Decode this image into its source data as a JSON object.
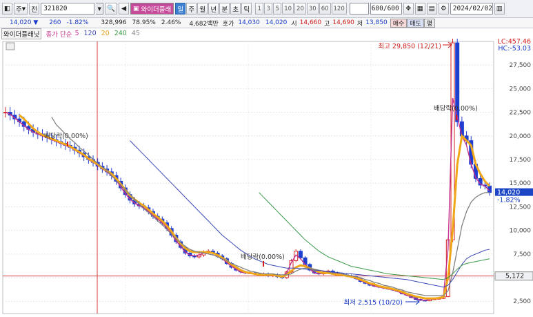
{
  "toolbar": {
    "period_label": "주",
    "search_label": "전",
    "code": "321820",
    "name": "와이더플래",
    "periods": [
      "일",
      "주",
      "월",
      "년",
      "분",
      "초",
      "틱"
    ],
    "period_selected": 0,
    "minutes": [
      "1",
      "3",
      "5",
      "10",
      "20",
      "30",
      "60",
      "120"
    ],
    "count": "600/600",
    "date": "2024/02/02"
  },
  "quote": {
    "price": "14,020",
    "arrow": "▼",
    "change": "260",
    "change_pct": "-1.82%",
    "volume": "328,996",
    "turnover": "78.95%",
    "vol_pct": "2.46%",
    "amount": "4,682백만",
    "hoga_label": "호가",
    "ask": "14,030",
    "bid": "14,020",
    "open_label": "시",
    "open": "14,660",
    "high_label": "고",
    "high": "14,690",
    "low_label": "저",
    "low": "13,850",
    "buy_label": "매수",
    "sell_label": "매도",
    "eval_label": "평"
  },
  "legend": {
    "name": "와이더플래닛",
    "ma_label": "종가 단순",
    "periods": [
      "5",
      "120",
      "20",
      "240",
      "45"
    ],
    "period_colors": [
      "#c62f8c",
      "#3c48b8",
      "#e8a020",
      "#3a9a48",
      "#888888"
    ]
  },
  "annotations": {
    "lc": "LC:457.46",
    "hc": "HC:-53.03",
    "max_label": "최고 29,850 (12/21)",
    "min_label": "최저 2,515 (10/20)",
    "div1": "배당락(0.00%)",
    "div2": "배당락(0.00%)",
    "div3": "배당락(0.00%)",
    "cur_price": "14,020",
    "cur_pct": "-1.82%",
    "level": "5,172"
  },
  "chart_data": {
    "type": "candlestick",
    "y_ticks": [
      2500,
      5000,
      7500,
      10000,
      12500,
      15000,
      17500,
      20000,
      22500,
      25000,
      27500
    ],
    "y_tick_labels": [
      "2,500",
      "5,000",
      "7,500",
      "10,000",
      "12,500",
      "15,000",
      "17,500",
      "20,000",
      "22,500",
      "25,000",
      "27,500"
    ],
    "ylim": [
      1200,
      30000
    ],
    "high": 29850,
    "low": 2515,
    "last": 14020,
    "horizontal_line": 5172,
    "close_series": [
      22500,
      22200,
      21800,
      21500,
      21000,
      20700,
      20400,
      20200,
      20000,
      19800,
      19600,
      19400,
      19200,
      19000,
      18800,
      18500,
      18200,
      17800,
      17500,
      17200,
      16800,
      16500,
      16200,
      15800,
      15200,
      14500,
      13800,
      13200,
      12800,
      12600,
      12400,
      12000,
      11500,
      11200,
      10800,
      10200,
      9500,
      8800,
      8200,
      7600,
      7300,
      7200,
      7400,
      7700,
      7800,
      7600,
      7300,
      7000,
      6500,
      6100,
      5800,
      5600,
      5500,
      5500,
      5400,
      5300,
      5400,
      5200,
      5300,
      5100,
      5000,
      5600,
      6800,
      7800,
      7100,
      6400,
      5800,
      5500,
      5400,
      5600,
      5700,
      5500,
      5400,
      5300,
      5200,
      5100,
      4900,
      4600,
      4400,
      4200,
      4100,
      4000,
      3900,
      3800,
      3700,
      3550,
      3300,
      3150,
      2900,
      2700,
      2600,
      2550,
      2700,
      2750,
      2800,
      3000,
      9000,
      29850,
      21500,
      20000,
      19500,
      17000,
      15500,
      14800,
      14700,
      14020
    ],
    "series": [
      {
        "name": "5",
        "values": [
          22500,
          22300,
          21900,
          21500,
          21100,
          20700,
          20400,
          20200,
          20000,
          19800,
          19600,
          19400,
          19200,
          19000,
          18800,
          18500,
          18200,
          17900,
          17500,
          17200,
          16900,
          16500,
          16200,
          15800,
          15300,
          14600,
          13900,
          13300,
          12900,
          12600,
          12400,
          12000,
          11600,
          11200,
          10800,
          10300,
          9600,
          8900,
          8300,
          7700,
          7400,
          7300,
          7400,
          7600,
          7700,
          7600,
          7300,
          7000,
          6600,
          6200,
          5900,
          5600,
          5500,
          5500,
          5400,
          5300,
          5400,
          5200,
          5300,
          5200,
          5100,
          5500,
          6600,
          7400,
          7000,
          6400,
          5900,
          5500,
          5400,
          5500,
          5600,
          5500,
          5400,
          5300,
          5200,
          5100,
          4900,
          4700,
          4500,
          4300,
          4100,
          4000,
          3900,
          3800,
          3700,
          3550,
          3350,
          3150,
          2950,
          2750,
          2650,
          2600,
          2700,
          2750,
          2800,
          3100,
          8000,
          24000,
          22000,
          20000,
          19000,
          17000,
          15600,
          14900,
          14700,
          14200
        ]
      },
      {
        "name": "20",
        "values": [
          null,
          null,
          null,
          22200,
          21800,
          21300,
          20800,
          20400,
          20100,
          19900,
          19700,
          19500,
          19300,
          19100,
          18900,
          18600,
          18300,
          18000,
          17600,
          17300,
          17000,
          16600,
          16300,
          16000,
          15500,
          14900,
          14300,
          13700,
          13300,
          12900,
          12600,
          12200,
          11800,
          11400,
          11000,
          10500,
          9900,
          9200,
          8600,
          8100,
          7800,
          7700,
          7700,
          7700,
          7700,
          7600,
          7400,
          7100,
          6800,
          6400,
          6100,
          5800,
          5600,
          5500,
          5400,
          5300,
          5300,
          5300,
          5300,
          5200,
          5100,
          5300,
          5700,
          6100,
          6300,
          6200,
          6000,
          5800,
          5600,
          5500,
          5500,
          5400,
          5300,
          5300,
          5200,
          5100,
          5000,
          4800,
          4600,
          4400,
          4300,
          4100,
          4000,
          3900,
          3800,
          3650,
          3500,
          3300,
          3150,
          3000,
          2900,
          2800,
          2800,
          2800,
          2850,
          2950,
          5000,
          10000,
          17000,
          20000,
          19500,
          19000,
          17000,
          16000,
          15200,
          14700
        ]
      },
      {
        "name": "45",
        "values": [
          null,
          null,
          null,
          null,
          null,
          null,
          null,
          null,
          null,
          null,
          22000,
          21200,
          20700,
          20200,
          19700,
          19300,
          18800,
          18400,
          18000,
          17500,
          17100,
          16700,
          16300,
          15800,
          15300,
          14800,
          14300,
          13800,
          13300,
          12800,
          12300,
          11900,
          11500,
          11000,
          10600,
          10100,
          9600,
          9100,
          8700,
          8300,
          8000,
          7800,
          7700,
          7600,
          7500,
          7400,
          7200,
          7000,
          6800,
          6500,
          6300,
          6100,
          5900,
          5700,
          5600,
          5500,
          5400,
          5400,
          5400,
          5300,
          5300,
          5300,
          5400,
          5700,
          5900,
          6000,
          6000,
          5900,
          5800,
          5700,
          5600,
          5500,
          5500,
          5400,
          5300,
          5200,
          5100,
          5000,
          4800,
          4700,
          4500,
          4400,
          4200,
          4100,
          4000,
          3800,
          3700,
          3500,
          3400,
          3300,
          3200,
          3100,
          3100,
          3100,
          3100,
          3100,
          3600,
          5500,
          8000,
          10500,
          12000,
          13000,
          13500,
          13800,
          14000,
          14000
        ]
      },
      {
        "name": "120",
        "values": [
          null,
          null,
          null,
          null,
          null,
          null,
          null,
          null,
          null,
          null,
          null,
          null,
          null,
          null,
          null,
          null,
          null,
          null,
          null,
          null,
          null,
          null,
          null,
          null,
          null,
          null,
          null,
          19500,
          19000,
          18500,
          18000,
          17500,
          17000,
          16500,
          16000,
          15500,
          15000,
          14500,
          14000,
          13500,
          13000,
          12500,
          12000,
          11500,
          11000,
          10500,
          10000,
          9500,
          9100,
          8700,
          8300,
          7900,
          7600,
          7300,
          7000,
          6800,
          6600,
          6400,
          6300,
          6200,
          6100,
          6000,
          6000,
          6000,
          5950,
          5900,
          5850,
          5800,
          5750,
          5700,
          5650,
          5600,
          5550,
          5500,
          5450,
          5400,
          5350,
          5300,
          5250,
          5200,
          5150,
          5100,
          5050,
          5000,
          4950,
          4900,
          4850,
          4800,
          4700,
          4600,
          4500,
          4400,
          4300,
          4200,
          4100,
          4000,
          4200,
          4800,
          5600,
          6400,
          7000,
          7300,
          7500,
          7700,
          7900,
          8000
        ]
      },
      {
        "name": "240",
        "values": [
          null,
          null,
          null,
          null,
          null,
          null,
          null,
          null,
          null,
          null,
          null,
          null,
          null,
          null,
          null,
          null,
          null,
          null,
          null,
          null,
          null,
          null,
          null,
          null,
          null,
          null,
          null,
          null,
          null,
          null,
          null,
          null,
          null,
          null,
          null,
          null,
          null,
          null,
          null,
          null,
          null,
          null,
          null,
          null,
          null,
          null,
          null,
          null,
          null,
          null,
          null,
          null,
          null,
          null,
          null,
          14000,
          13500,
          13000,
          12500,
          12000,
          11500,
          11000,
          10500,
          10000,
          9500,
          9000,
          8600,
          8200,
          7800,
          7500,
          7200,
          7000,
          6800,
          6600,
          6400,
          6200,
          6100,
          6000,
          5900,
          5800,
          5700,
          5600,
          5500,
          5400,
          5350,
          5300,
          5250,
          5200,
          5150,
          5100,
          5050,
          5000,
          4950,
          4900,
          4850,
          4800,
          5000,
          5400,
          5900,
          6300,
          6500,
          6600,
          6700,
          6800,
          6900,
          7000
        ]
      }
    ]
  }
}
